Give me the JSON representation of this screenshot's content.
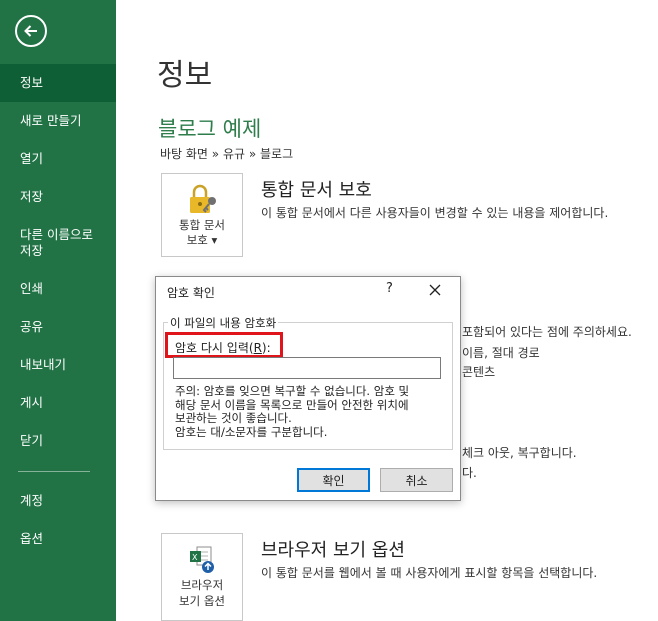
{
  "sidebar": {
    "items": [
      {
        "label": "정보"
      },
      {
        "label": "새로 만들기"
      },
      {
        "label": "열기"
      },
      {
        "label": "저장"
      },
      {
        "label": "다른 이름으로 저장"
      },
      {
        "label": "인쇄"
      },
      {
        "label": "공유"
      },
      {
        "label": "내보내기"
      },
      {
        "label": "게시"
      },
      {
        "label": "닫기"
      },
      {
        "label": "계정"
      },
      {
        "label": "옵션"
      }
    ],
    "colors": {
      "background": "#217346",
      "active": "#0f5f36"
    }
  },
  "main": {
    "page_title": "정보",
    "doc_name": "블로그 예제",
    "breadcrumb": "바탕 화면 » 유규 » 블로그",
    "protect": {
      "tile_line1": "통합 문서",
      "tile_line2": "보호 ▾",
      "title": "통합 문서 보호",
      "desc": "이 통합 문서에서 다른 사용자들이 변경할 수 있는 내용을 제어합니다."
    },
    "background_fragments": {
      "line1": "포함되어 있다는 점에 주의하세요.",
      "line2": "이름, 절대 경로",
      "line3": "콘텐츠",
      "line4": "체크 아웃, 복구합니다.",
      "line5": "다."
    },
    "browser": {
      "tile_line1": "브라우저",
      "tile_line2": "보기 옵션",
      "title": "브라우저 보기 옵션",
      "desc": "이 통합 문서를 웹에서 볼 때 사용자에게 표시할 항목을 선택합니다."
    }
  },
  "dialog": {
    "title": "암호 확인",
    "help": "?",
    "group_label": "이 파일의 내용 암호화",
    "field_label": "암호 다시 입력",
    "field_accel_prefix": "(",
    "field_accel": "R",
    "field_accel_suffix": "):",
    "field_value": "",
    "notice_lines": [
      "주의: 암호를 잊으면 복구할 수 없습니다. 암호 및",
      "해당 문서 이름을 목록으로 만들어 안전한 위치에",
      "보관하는 것이 좋습니다.",
      "암호는 대/소문자를 구분합니다."
    ],
    "ok_label": "확인",
    "cancel_label": "취소",
    "highlight_color": "#e0141b"
  }
}
